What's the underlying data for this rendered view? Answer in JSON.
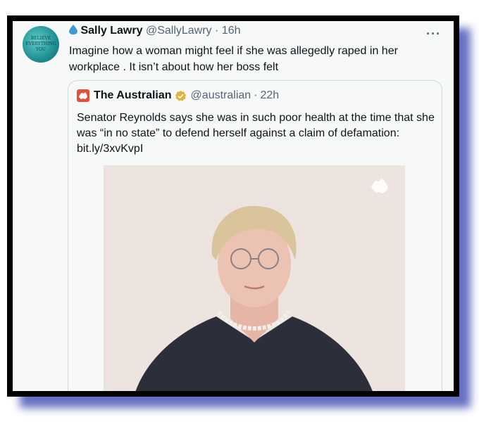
{
  "tweet": {
    "author_name": "Sally Lawry",
    "handle": "@SallyLawry",
    "separator": "·",
    "time": "16h",
    "text": "Imagine how a woman might feel if she was allegedly raped in her workplace . It isn’t about how her boss felt",
    "avatar_lines": [
      "BELIEVE",
      "EVERYTHING",
      "YOU"
    ]
  },
  "quoted": {
    "author_name": "The Australian",
    "handle": "@australian",
    "separator": "·",
    "time": "22h",
    "text": "Senator Reynolds says she was in such poor health at the time that she was “in no state” to defend herself against a claim of defamation: bit.ly/3xvKvpI"
  },
  "icons": {
    "author_prefix": "water-drop-icon",
    "more": "more-options-icon",
    "verified": "gold-verified-badge-icon",
    "publisher_logo": "the-australian-logo-icon",
    "photo_watermark": "australia-map-icon"
  },
  "colors": {
    "frame": "#000000",
    "shadow": "#4a57b8",
    "drop": "#3b9bd6",
    "logo": "#e2523b",
    "verified": "#e3b23c"
  },
  "more_label": "···"
}
